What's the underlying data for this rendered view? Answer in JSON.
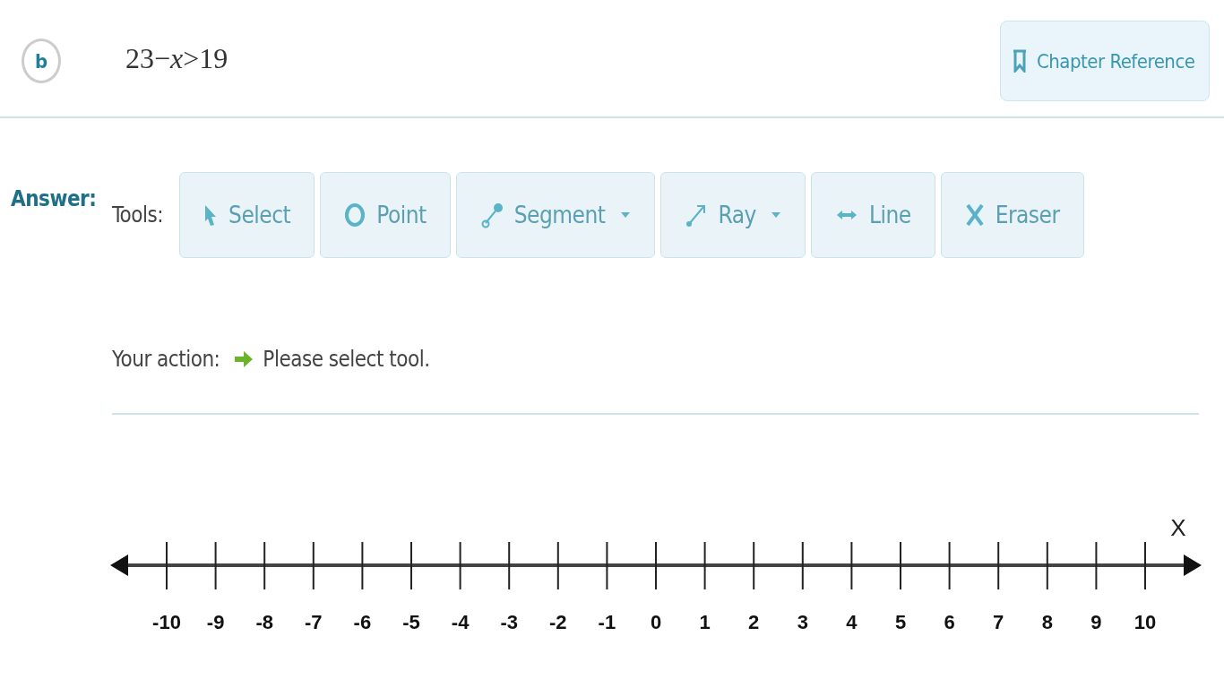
{
  "question": {
    "badge": "b",
    "equation": "23−*x*>19"
  },
  "chapter_button": {
    "label": "Chapter Reference"
  },
  "answer_label": "Answer:",
  "tools_label": "Tools:",
  "tools": [
    {
      "kind": "select",
      "label": "Select",
      "dropdown": false
    },
    {
      "kind": "point",
      "label": "Point",
      "dropdown": false
    },
    {
      "kind": "segment",
      "label": "Segment",
      "dropdown": true
    },
    {
      "kind": "ray",
      "label": "Ray",
      "dropdown": true
    },
    {
      "kind": "line",
      "label": "Line",
      "dropdown": false
    },
    {
      "kind": "eraser",
      "label": "Eraser",
      "dropdown": false
    }
  ],
  "action": {
    "label": "Your action:",
    "message": "Please select tool."
  },
  "number_line": {
    "axis_label": "X",
    "ticks": [
      "-10",
      "-9",
      "-8",
      "-7",
      "-6",
      "-5",
      "-4",
      "-3",
      "-2",
      "-1",
      "0",
      "1",
      "2",
      "3",
      "4",
      "5",
      "6",
      "7",
      "8",
      "9",
      "10"
    ]
  }
}
